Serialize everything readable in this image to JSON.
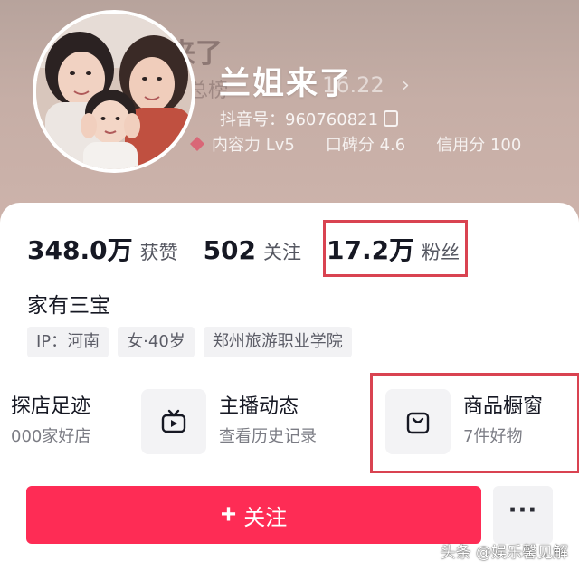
{
  "profile": {
    "background_ghost_title": "来了",
    "background_ghost_sub": "总榜",
    "background_ghost_ver": "16.22",
    "nickname": "兰姐来了",
    "douyin_id": "抖音号：960760821",
    "scores": [
      {
        "label": "内容力 Lv5"
      },
      {
        "label": "口碑分 4.6"
      },
      {
        "label": "信用分 100"
      }
    ]
  },
  "stats": {
    "likes_num": "348.0万",
    "likes_label": "获赞",
    "following_num": "502",
    "following_label": "关注",
    "fans_num": "17.2万",
    "fans_label": "粉丝"
  },
  "bio": "家有三宝",
  "tags": [
    "IP：河南",
    "女·40岁",
    "郑州旅游职业学院"
  ],
  "features": {
    "store": {
      "title": "探店足迹",
      "subtitle": "000家好店",
      "icon": "map-pin-icon"
    },
    "live": {
      "title": "主播动态",
      "subtitle": "查看历史记录",
      "icon": "tv-icon"
    },
    "shop": {
      "title": "商品橱窗",
      "subtitle": "7件好物",
      "icon": "shopping-bag-icon"
    }
  },
  "actions": {
    "follow_plus": "+",
    "follow_label": "关注",
    "more_label": "···"
  },
  "watermark": "头条 @娱乐馨见解",
  "colors": {
    "accent": "#fe2c55",
    "highlight_box": "#d94351",
    "header_bg": "#c6aea6"
  }
}
